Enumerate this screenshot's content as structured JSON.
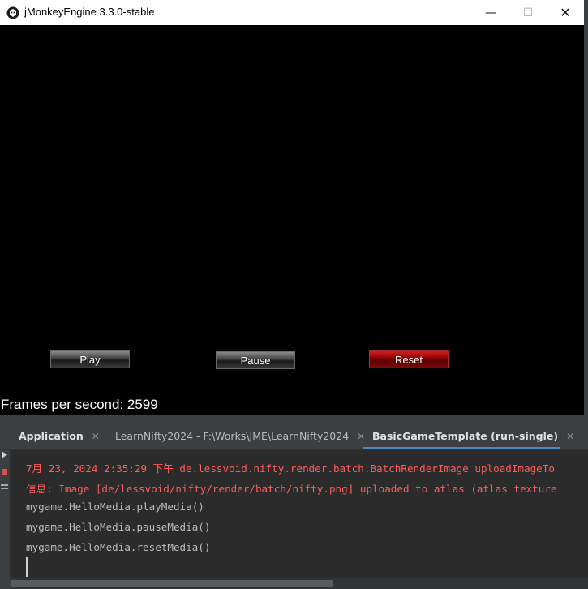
{
  "window": {
    "title": "jMonkeyEngine 3.3.0-stable",
    "minimize_glyph": "—",
    "maximize_glyph": "☐",
    "close_glyph": "✕"
  },
  "game": {
    "buttons": {
      "play": "Play",
      "pause": "Pause",
      "reset": "Reset"
    },
    "fps_text": "Frames per second: 2599"
  },
  "ide": {
    "tabs": [
      {
        "label": "Application",
        "close": "✕"
      },
      {
        "label": "LearnNifty2024 - F:\\Works\\JME\\LearnNifty2024",
        "close": "✕"
      },
      {
        "label": "BasicGameTemplate (run-single)",
        "close": "✕"
      }
    ],
    "console_lines": [
      "7月 23, 2024 2:35:29 下午 de.lessvoid.nifty.render.batch.BatchRenderImage uploadImageTo",
      "信息: Image [de/lessvoid/nifty/render/batch/nifty.png] uploaded to atlas (atlas texture",
      "mygame.HelloMedia.playMedia()",
      "mygame.HelloMedia.pauseMedia()",
      "mygame.HelloMedia.resetMedia()"
    ]
  },
  "colors": {
    "console_error": "#ff5c5c",
    "console_text": "#bbbbbb",
    "active_tab_underline": "#4a88c7",
    "reset_button": "#8a0000"
  },
  "icons": [
    "jmonkey-app-icon",
    "minimize-icon",
    "maximize-icon",
    "close-icon",
    "rerun-icon",
    "stop-icon"
  ]
}
